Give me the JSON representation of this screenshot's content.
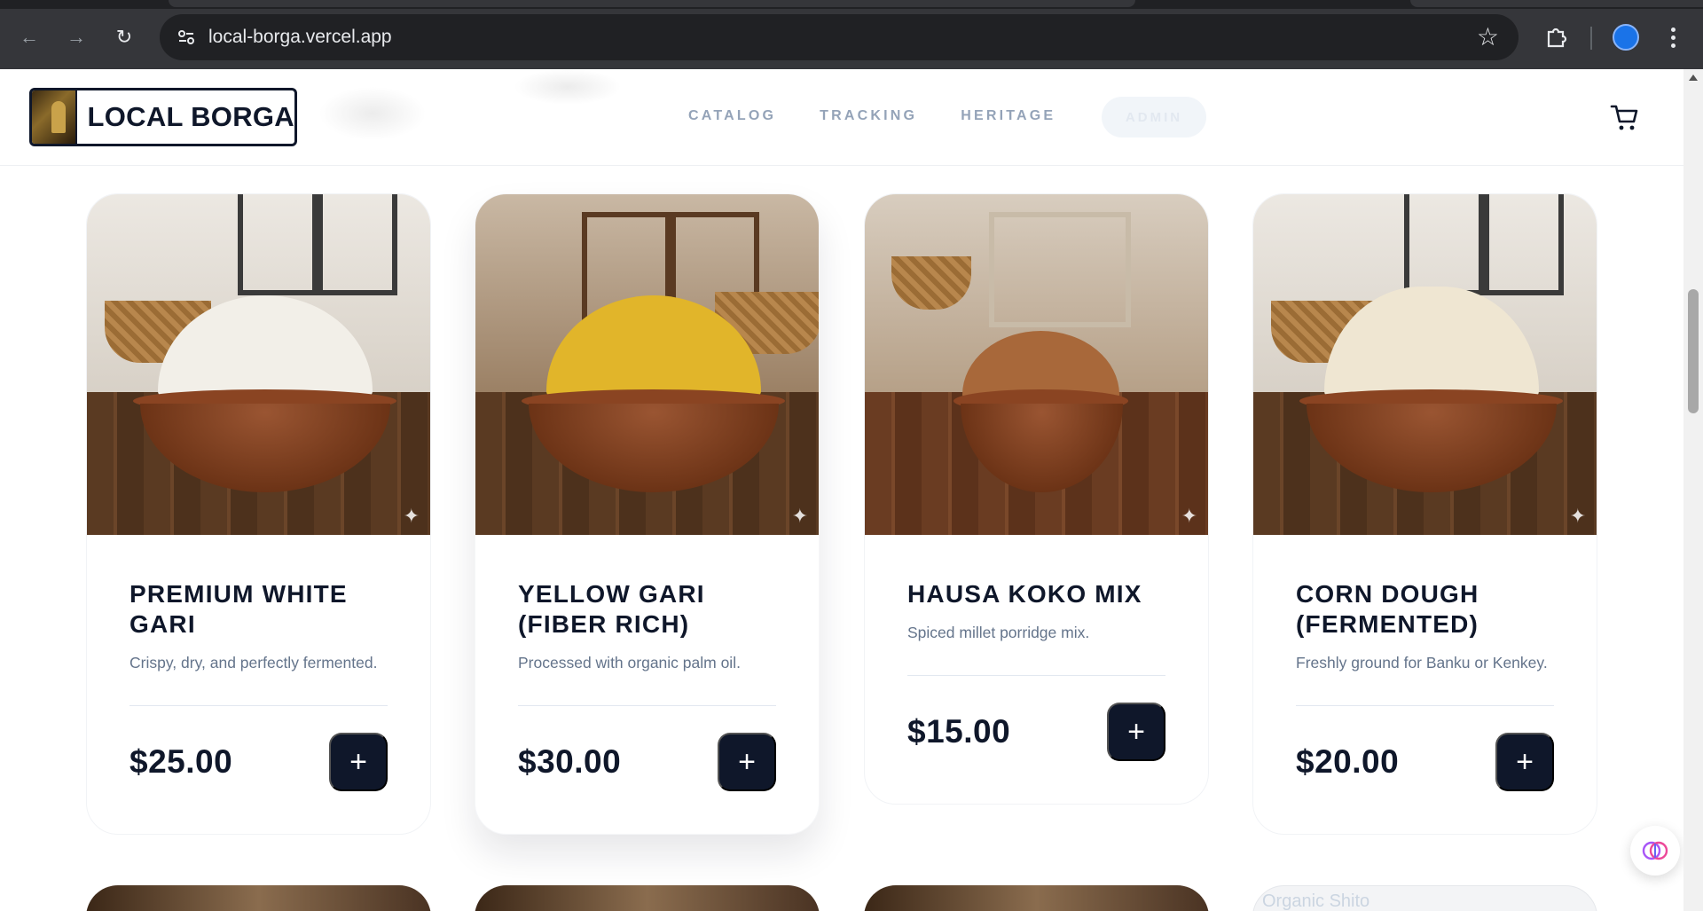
{
  "browser": {
    "url": "local-borga.vercel.app"
  },
  "site": {
    "logo_text": "LOCAL BORGA",
    "nav": [
      {
        "label": "CATALOG"
      },
      {
        "label": "TRACKING"
      },
      {
        "label": "HERITAGE"
      }
    ],
    "admin_label": "ADMIN"
  },
  "products": [
    {
      "name": "PREMIUM WHITE GARI",
      "description": "Crispy, dry, and perfectly fermented.",
      "price": "$25.00",
      "add_label": "+",
      "heap_color": "#f2efe8"
    },
    {
      "name": "YELLOW GARI (FIBER RICH)",
      "description": "Processed with organic palm oil.",
      "price": "$30.00",
      "add_label": "+",
      "heap_color": "#e1b52a"
    },
    {
      "name": "HAUSA KOKO MIX",
      "description": "Spiced millet porridge mix.",
      "price": "$15.00",
      "add_label": "+",
      "heap_color": "#a8683a"
    },
    {
      "name": "CORN DOUGH (FERMENTED)",
      "description": "Freshly ground for Banku or Kenkey.",
      "price": "$20.00",
      "add_label": "+",
      "heap_color": "#efe6d2"
    }
  ],
  "next_row": {
    "broken_image_alt": "Organic Shito"
  },
  "colors": {
    "primary": "#0f172a",
    "muted_text": "#64748b",
    "nav_text": "#94a3b8"
  },
  "icons": [
    "back-icon",
    "forward-icon",
    "reload-icon",
    "site-info-icon",
    "bookmark-star-icon",
    "extensions-icon",
    "profile-avatar",
    "menu-dots-icon",
    "cart-icon",
    "sparkle-icon",
    "ai-brain-icon"
  ]
}
